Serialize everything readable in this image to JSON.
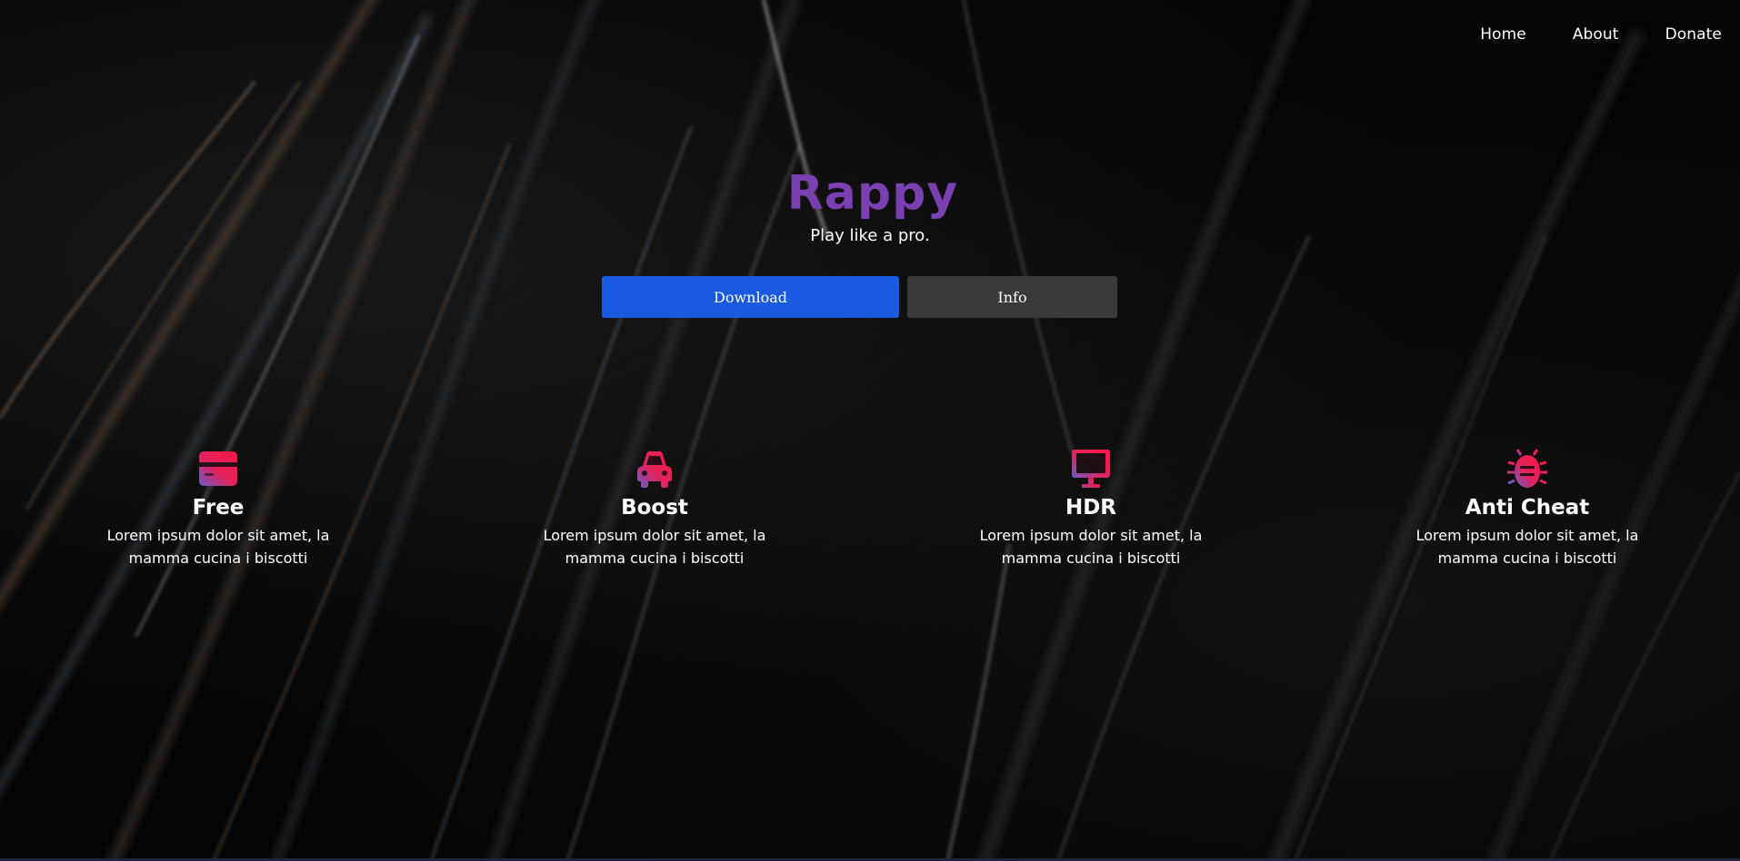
{
  "nav": {
    "items": [
      {
        "label": "Home"
      },
      {
        "label": "About"
      },
      {
        "label": "Donate"
      }
    ]
  },
  "hero": {
    "title": "Rappy",
    "tagline": "Play like a pro.",
    "download_label": "Download",
    "info_label": "Info"
  },
  "features": [
    {
      "icon": "credit-card-icon",
      "title": "Free",
      "description": "Lorem ipsum dolor sit amet, la mamma cucina i biscotti"
    },
    {
      "icon": "car-icon",
      "title": "Boost",
      "description": "Lorem ipsum dolor sit amet, la mamma cucina i biscotti"
    },
    {
      "icon": "monitor-icon",
      "title": "HDR",
      "description": "Lorem ipsum dolor sit amet, la mamma cucina i biscotti"
    },
    {
      "icon": "bug-icon",
      "title": "Anti Cheat",
      "description": "Lorem ipsum dolor sit amet, la mamma cucina i biscotti"
    }
  ],
  "colors": {
    "brand": "#7a3fb0",
    "download_button": "#1a5ae0",
    "info_button": "#3a3a3a",
    "icon_gradient_start": "#ff1744",
    "icon_gradient_end": "#6a5acd"
  }
}
